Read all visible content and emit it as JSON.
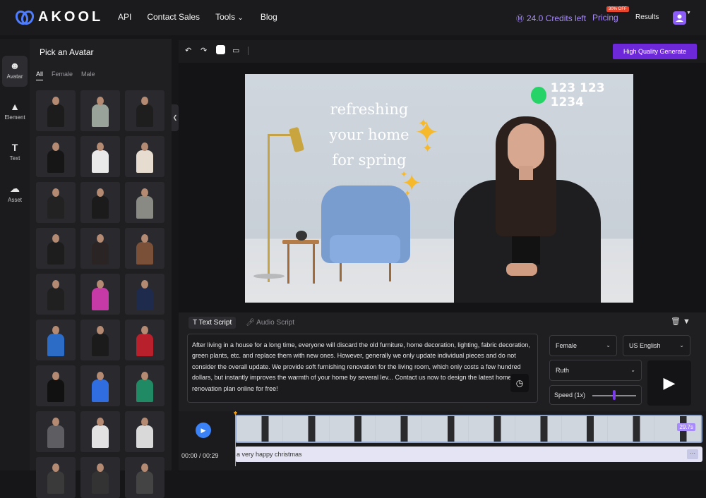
{
  "brand": {
    "logo_text": "AKOOL"
  },
  "nav": {
    "items": [
      "API",
      "Contact Sales",
      "Tools",
      "Blog"
    ]
  },
  "header": {
    "credits": "24.0 Credits left",
    "pricing": "Pricing",
    "pricing_badge": "30% OFF",
    "results": "Results"
  },
  "rail": {
    "items": [
      "Avatar",
      "Element",
      "Text",
      "Asset"
    ]
  },
  "avatar_panel": {
    "title": "Pick an Avatar",
    "tabs": [
      "All",
      "Female",
      "Male"
    ]
  },
  "toolbar": {
    "generate": "High Quality Generate"
  },
  "video": {
    "phone": "123 123 1234",
    "overlay_lines": [
      "refreshing",
      "your home",
      "for spring"
    ]
  },
  "script_tabs": {
    "text": "Text Script",
    "audio": "Audio Script"
  },
  "script": {
    "text": "After living in a house for a long time, everyone will discard the old furniture, home decoration, lighting, fabric decoration, green plants, etc. and replace them with new ones. However, generally we only update individual pieces and do not consider the overall update. We provide soft furnishing renovation for the living room, which only costs a few hundred dollars, but instantly improves the warmth of your home by several lev... Contact us now to design the latest home renovation plan online for free!"
  },
  "voice": {
    "gender": "Female",
    "language": "US English",
    "name": "Ruth",
    "speed_label": "Speed (1x)",
    "speed": 0.5
  },
  "timeline": {
    "time": "00:00 / 00:29",
    "duration_badge": "29.7s",
    "caption": "a very happy christmas"
  },
  "colors": {
    "accent": "#6d28d9",
    "accent_text": "#a78bfa",
    "badge": "#e8452d",
    "whatsapp": "#25d366",
    "star": "#f6b92b"
  }
}
